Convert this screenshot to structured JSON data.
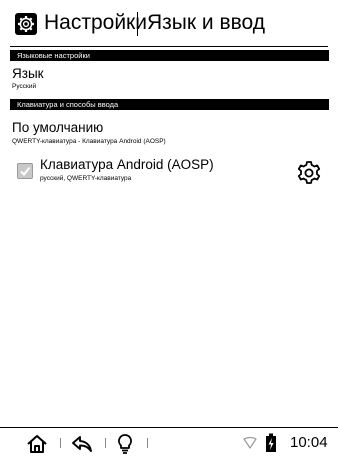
{
  "header": {
    "app_title": "Настройки",
    "page_title": "Язык и ввод"
  },
  "sections": {
    "language_settings": {
      "header": "Языковые настройки",
      "language": {
        "title": "Язык",
        "value": "Русский"
      }
    },
    "keyboard_input": {
      "header": "Клавиатура и способы ввода",
      "default": {
        "title": "По умолчанию",
        "value": "QWERTY-клавиатура - Клавиатура Android (AOSP)"
      },
      "keyboard": {
        "title": "Клавиатура Android (AOSP)",
        "value": "русский, QWERTY-клавиатура",
        "checked": true
      }
    }
  },
  "status_bar": {
    "time": "10:04",
    "icons": [
      "home-icon",
      "back-icon",
      "lightbulb-icon",
      "wifi-icon",
      "battery-charging-icon"
    ]
  },
  "colors": {
    "text": "#000000",
    "section_bar": "#000000",
    "checkbox": "#c8c8c8"
  }
}
